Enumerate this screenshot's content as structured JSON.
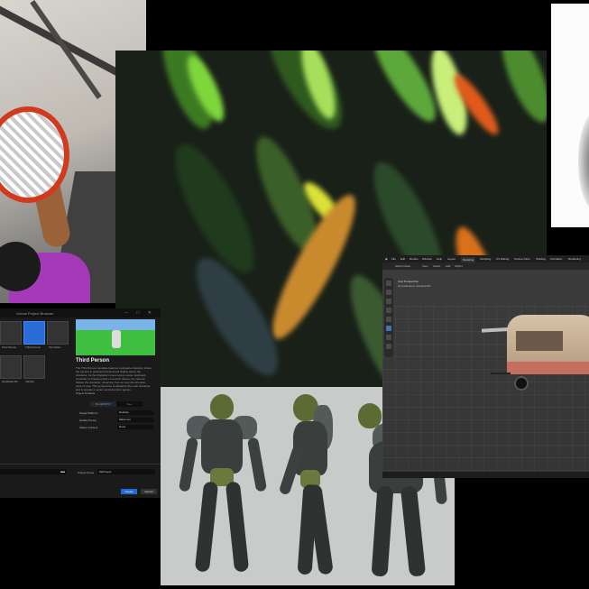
{
  "unreal": {
    "window_title": "Unreal Project Browser",
    "templates": [
      {
        "label": "First Person"
      },
      {
        "label": "Third Person"
      },
      {
        "label": "Top Down"
      },
      {
        "label": "Handheld AR"
      },
      {
        "label": "Vehicle"
      }
    ],
    "selected_project": "Third Person",
    "description": "The Third Person template features a playable character where the camera is positioned behind and slightly above the character. As the character moves using mouse, keyboard, controller or virtual joystick on a touch device, the camera follows the character, observing from an over-the-shoulder point of view. This perspective emphasizes the main character and is popular in action and adventure games.",
    "defaults_header": "Project Defaults",
    "blueprint_toggle": {
      "on": "BLUEPRINT",
      "off": "C++"
    },
    "settings": [
      {
        "key": "Target Platform",
        "value": "Desktop"
      },
      {
        "key": "Quality Preset",
        "value": "Maximum"
      },
      {
        "key": "Starter Content",
        "value": "None"
      }
    ],
    "project_name_label": "Project Name",
    "project_name": "MyProject",
    "create_label": "Create",
    "cancel_label": "Cancel"
  },
  "blender": {
    "menu": [
      "File",
      "Edit",
      "Render",
      "Window",
      "Help"
    ],
    "workspaces": [
      "Layout",
      "Modeling",
      "Sculpting",
      "UV Editing",
      "Texture Paint",
      "Shading",
      "Animation",
      "Rendering"
    ],
    "active_workspace": "Modeling",
    "header": [
      "Object Mode",
      "View",
      "Select",
      "Add",
      "Object"
    ],
    "view_title": "User Perspective",
    "collection_info": "(1) Collection | Camera.001"
  }
}
